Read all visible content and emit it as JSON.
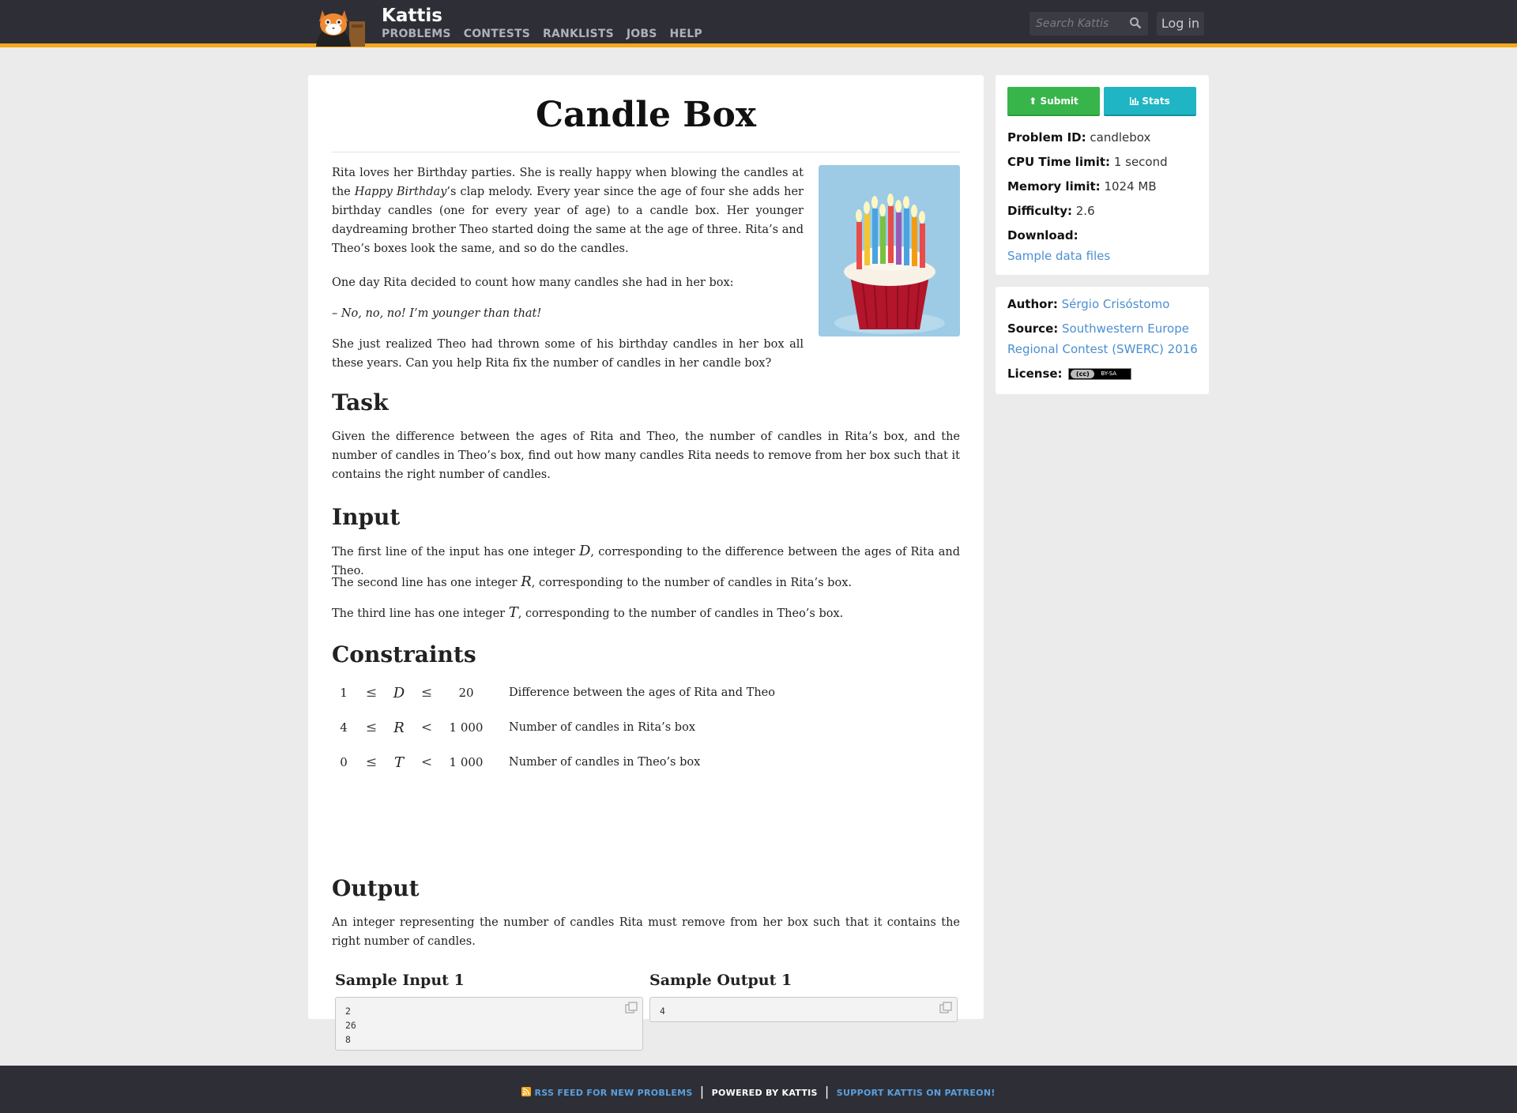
{
  "header": {
    "brand": "Kattis",
    "nav": [
      "PROBLEMS",
      "CONTESTS",
      "RANKLISTS",
      "JOBS",
      "HELP"
    ],
    "search_placeholder": "Search Kattis",
    "login": "Log in"
  },
  "problem": {
    "title": "Candle Box",
    "intro_p1_a": "Rita loves her Birthday parties. She is really happy when blowing the candles at the ",
    "intro_p1_em": "Happy Birthday",
    "intro_p1_b": "’s clap melody. Every year since the age of four she adds her birthday candles (one for every year of age) to a candle box. Her younger daydreaming brother Theo started doing the same at the age of three. Rita’s and Theo’s boxes look the same, and so do the candles.",
    "intro_p2": "One day Rita decided to count how many candles she had in her box:",
    "intro_p3": "– No, no, no! I’m younger than that!",
    "intro_p4": "She just realized Theo had thrown some of his birthday candles in her box all these years. Can you help Rita fix the number of candles in her candle box?",
    "task_heading": "Task",
    "task_text": "Given the difference between the ages of Rita and Theo, the number of candles in Rita’s box, and the number of candles in Theo’s box, find out how many candles Rita needs to remove from her box such that it contains the right number of candles.",
    "input_heading": "Input",
    "input_lines": [
      {
        "pre": "The first line of the input has one integer ",
        "var": "D",
        "post": ", corresponding to the difference between the ages of Rita and Theo."
      },
      {
        "pre": "The second line has one integer ",
        "var": "R",
        "post": ", corresponding to the number of candles in Rita’s box."
      },
      {
        "pre": "The third line has one integer ",
        "var": "T",
        "post": ", corresponding to the number of candles in Theo’s box."
      }
    ],
    "constraints_heading": "Constraints",
    "constraints": [
      {
        "min": "1",
        "op1": "≤",
        "var": "D",
        "op2": "≤",
        "max": "20",
        "desc": "Difference between the ages of Rita and Theo"
      },
      {
        "min": "4",
        "op1": "≤",
        "var": "R",
        "op2": "<",
        "max": "1 000",
        "desc": "Number of candles in Rita’s box"
      },
      {
        "min": "0",
        "op1": "≤",
        "var": "T",
        "op2": "<",
        "max": "1 000",
        "desc": "Number of candles in Theo’s box"
      }
    ],
    "output_heading": "Output",
    "output_text": "An integer representing the number of candles Rita must remove from her box such that it contains the right number of candles.",
    "sample_input_heading": "Sample Input 1",
    "sample_input": [
      "2",
      "26",
      "8"
    ],
    "sample_output_heading": "Sample Output 1",
    "sample_output": [
      "4"
    ]
  },
  "sidebar": {
    "submit": "Submit",
    "stats": "Stats",
    "problem_id_label": "Problem ID:",
    "problem_id": "candlebox",
    "cpu_label": "CPU Time limit:",
    "cpu": "1 second",
    "memory_label": "Memory limit:",
    "memory": "1024 MB",
    "difficulty_label": "Difficulty:",
    "difficulty": "2.6",
    "download_label": "Download:",
    "download_link": "Sample data files",
    "author_label": "Author:",
    "author": "Sérgio Crisóstomo",
    "source_label": "Source:",
    "source_line1": "Southwestern Europe",
    "source_line2": "Regional Contest (SWERC) 2016",
    "license_label": "License:",
    "license_badge": "BY-SA"
  },
  "footer": {
    "rss": "RSS FEED FOR NEW PROBLEMS",
    "powered": "POWERED BY KATTIS",
    "patreon": "SUPPORT KATTIS ON PATREON!"
  },
  "colors": {
    "topbar": "#2e2f36",
    "accent": "#f5a81a",
    "submit": "#38b54a",
    "stats": "#1fb5c4",
    "link": "#4b8fd0"
  }
}
